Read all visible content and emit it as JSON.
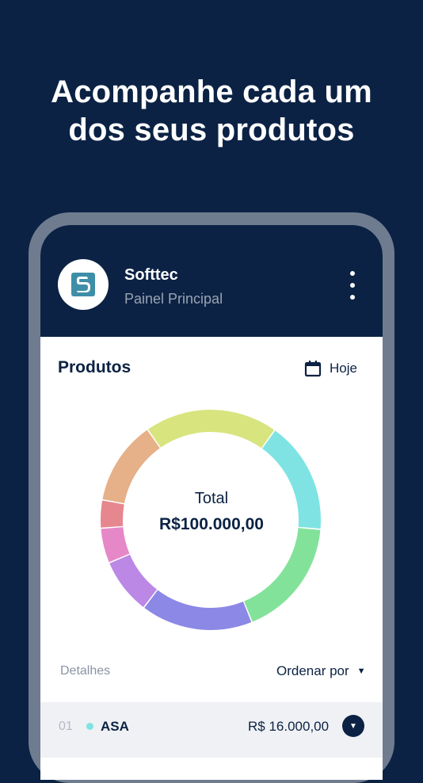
{
  "headline": {
    "line1": "Acompanhe cada um",
    "line2": "dos seus produtos"
  },
  "app": {
    "company_name": "Softtec",
    "subtitle": "Painel Principal",
    "logo_icon": "softtec-logo-icon",
    "menu_icon": "more-vertical-icon"
  },
  "products": {
    "title": "Produtos",
    "date_filter_icon": "calendar-icon",
    "date_filter_label": "Hoje"
  },
  "chart_data": {
    "type": "pie",
    "donut": true,
    "center_label": "Total",
    "center_value": "R$100.000,00",
    "slices": [
      {
        "color": "#7fe3e3",
        "share": 16
      },
      {
        "color": "#83e29a",
        "share": 17
      },
      {
        "color": "#8b88e6",
        "share": 16
      },
      {
        "color": "#bb88e6",
        "share": 8
      },
      {
        "color": "#e688c8",
        "share": 5
      },
      {
        "color": "#e6868e",
        "share": 4
      },
      {
        "color": "#e6b088",
        "share": 12
      },
      {
        "color": "#d8e47e",
        "share": 19
      }
    ]
  },
  "details": {
    "label": "Detalhes",
    "sort_label": "Ordenar por",
    "sort_icon": "caret-down-icon"
  },
  "rows": [
    {
      "index": "01",
      "name": "ASA",
      "value": "R$ 16.000,00",
      "color": "#7fe3e3",
      "expand_icon": "chevron-down-icon"
    }
  ],
  "colors": {
    "brand_navy": "#0b2244",
    "phone_frame": "#6f7c8f"
  }
}
